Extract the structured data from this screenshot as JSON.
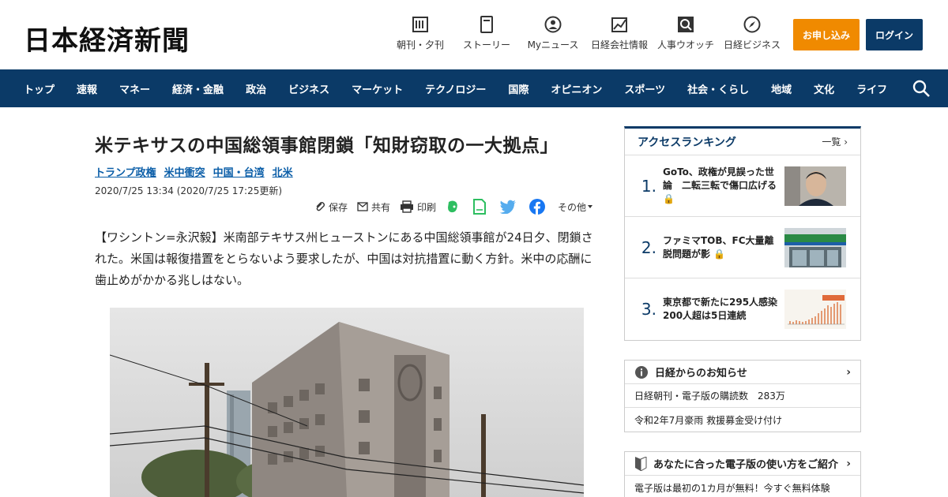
{
  "header": {
    "logo": "日本経済新聞",
    "links": [
      {
        "label": "朝刊・夕刊",
        "icon": "newspaper-icon"
      },
      {
        "label": "ストーリー",
        "icon": "story-icon"
      },
      {
        "label": "Myニュース",
        "icon": "user-icon"
      },
      {
        "label": "日経会社情報",
        "icon": "chart-icon"
      },
      {
        "label": "人事ウオッチ",
        "icon": "search-person-icon"
      },
      {
        "label": "日経ビジネス",
        "icon": "compass-icon"
      }
    ],
    "apply_label": "お申し込み",
    "login_label": "ログイン",
    "apply_color": "#f08a00",
    "brand_color": "#0b3a67"
  },
  "nav": {
    "items": [
      "トップ",
      "速報",
      "マネー",
      "経済・金融",
      "政治",
      "ビジネス",
      "マーケット",
      "テクノロジー",
      "国際",
      "オピニオン",
      "スポーツ",
      "社会・くらし",
      "地域",
      "文化",
      "ライフ"
    ]
  },
  "article": {
    "title": "米テキサスの中国総領事館閉鎖「知財窃取の一大拠点」",
    "tags": [
      "トランプ政権",
      "米中衝突",
      "中国・台湾",
      "北米"
    ],
    "date": "2020/7/25 13:34 (2020/7/25 17:25更新)",
    "tools": {
      "save": "保存",
      "share": "共有",
      "print": "印刷",
      "more": "その他"
    },
    "lead": "【ワシントン=永沢毅】米南部テキサス州ヒューストンにある中国総領事館が24日夕、閉鎖された。米国は報復措置をとらないよう要求したが、中国は対抗措置に動く方針。米中の応酬に歯止めがかかる兆しはない。"
  },
  "ranking": {
    "title": "アクセスランキング",
    "more": "一覧",
    "items": [
      {
        "num": "1.",
        "text": "GoTo、政権が見誤った世論　二転三転で傷口広げる",
        "locked": true
      },
      {
        "num": "2.",
        "text": "ファミマTOB、FC大量離脱問題が影",
        "locked": true
      },
      {
        "num": "3.",
        "text": "東京都で新たに295人感染　200人超は5日連続",
        "locked": false
      }
    ]
  },
  "notice": {
    "title": "日経からのお知らせ",
    "rows": [
      "日経朝刊・電子版の購読数　283万",
      "令和2年7月豪雨 救援募金受け付け"
    ]
  },
  "guide": {
    "title": "あなたに合った電子版の使い方をご紹介",
    "rows": [
      "電子版は最初の1カ月が無料！今すぐ無料体験"
    ]
  }
}
